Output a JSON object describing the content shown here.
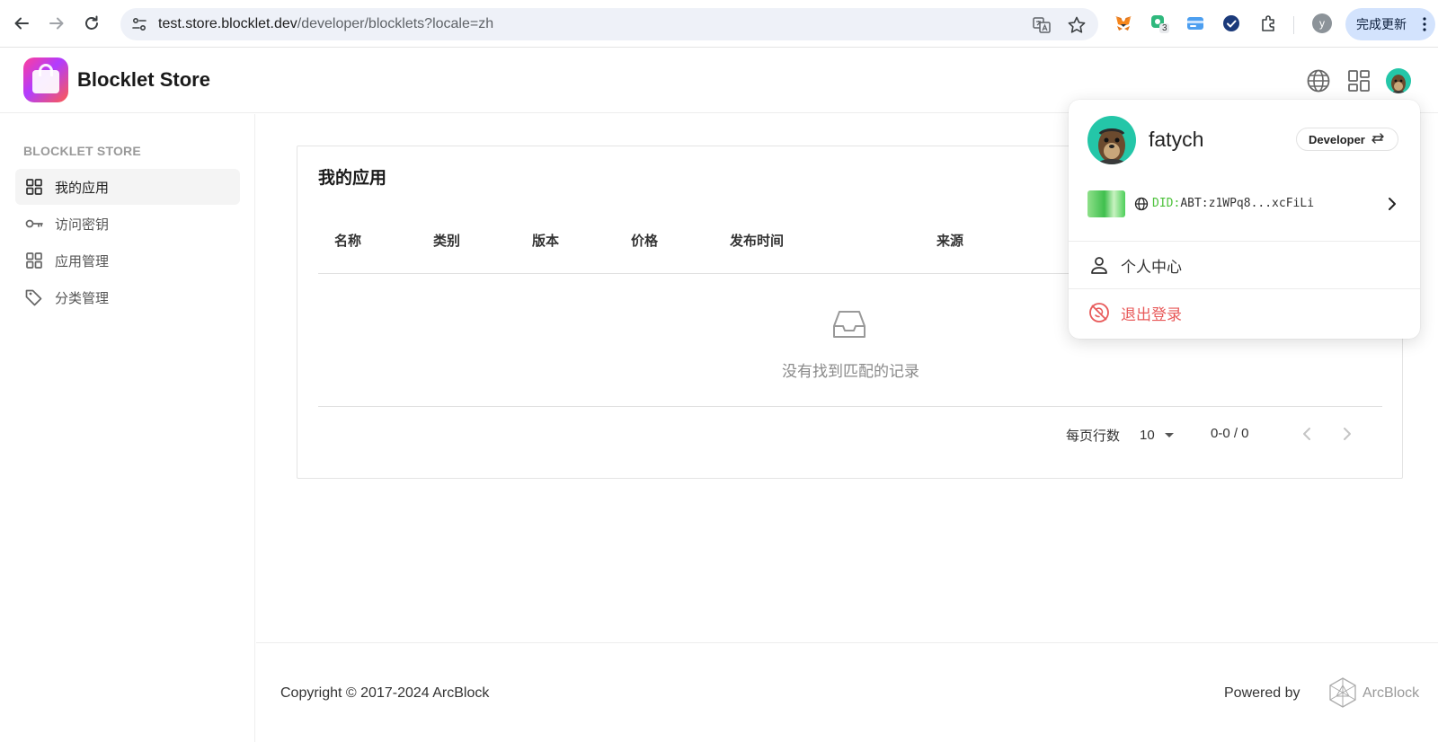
{
  "browser": {
    "url_host": "test.store.blocklet.dev",
    "url_path": "/developer/blocklets?locale=zh",
    "extension_badge": "3",
    "profile_initial": "y",
    "update_label": "完成更新"
  },
  "header": {
    "app_title": "Blocklet Store"
  },
  "sidebar": {
    "heading": "BLOCKLET STORE",
    "items": [
      {
        "label": "我的应用",
        "icon": "grid-icon",
        "active": true
      },
      {
        "label": "访问密钥",
        "icon": "key-icon",
        "active": false
      },
      {
        "label": "应用管理",
        "icon": "grid-icon",
        "active": false
      },
      {
        "label": "分类管理",
        "icon": "tag-icon",
        "active": false
      }
    ]
  },
  "main": {
    "title": "我的应用",
    "columns": [
      "名称",
      "类别",
      "版本",
      "价格",
      "发布时间",
      "来源"
    ],
    "empty_text": "没有找到匹配的记录",
    "pagination": {
      "rows_per_page_label": "每页行数",
      "rows_per_page": "10",
      "range": "0-0 / 0"
    }
  },
  "footer": {
    "copyright": "Copyright © 2017-2024  ArcBlock",
    "powered_by": "Powered by",
    "brand": "ArcBlock"
  },
  "user_menu": {
    "name": "fatych",
    "role": "Developer",
    "did_prefix": "DID:",
    "did_value": "ABT:z1WPq8...xcFiLi",
    "items": [
      {
        "label": "个人中心",
        "icon": "person-icon"
      },
      {
        "label": "退出登录",
        "icon": "logout-icon"
      }
    ]
  },
  "colors": {
    "accent_green": "#4cc13a",
    "logout_red": "#e85a5a",
    "update_button_bg": "#d3e3fd"
  }
}
